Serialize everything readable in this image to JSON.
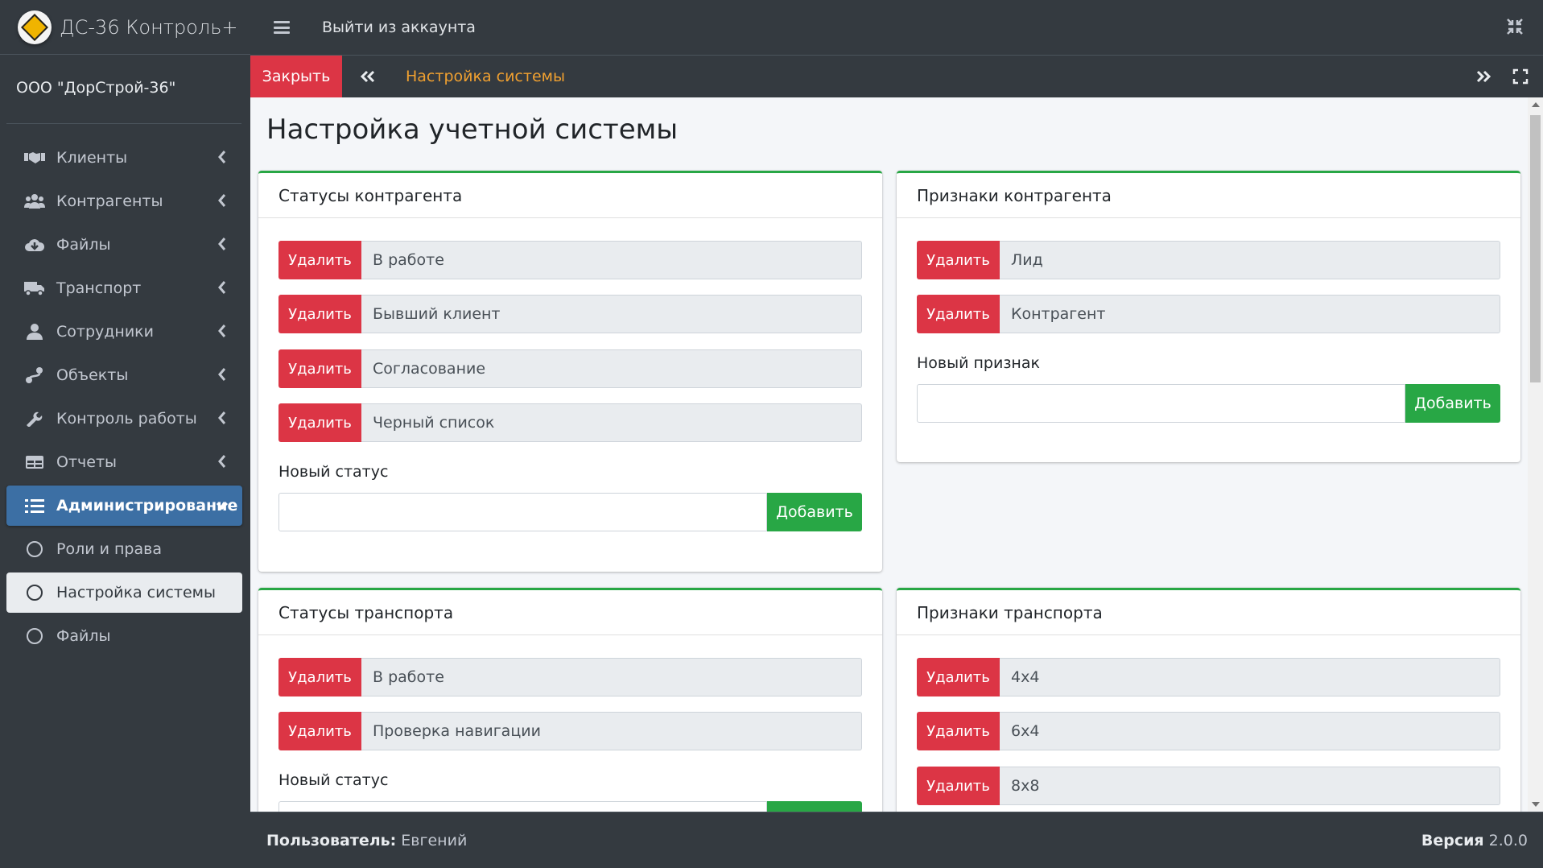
{
  "brand": {
    "name": "ДС-36 Контроль+"
  },
  "org": {
    "name": "ООО \"ДорСтрой-36\""
  },
  "sidebar": {
    "items": [
      {
        "label": "Клиенты",
        "icon": "handshake-icon"
      },
      {
        "label": "Контрагенты",
        "icon": "users-icon"
      },
      {
        "label": "Файлы",
        "icon": "cloud-download-icon"
      },
      {
        "label": "Транспорт",
        "icon": "truck-icon"
      },
      {
        "label": "Сотрудники",
        "icon": "user-icon"
      },
      {
        "label": "Объекты",
        "icon": "route-icon"
      },
      {
        "label": "Контроль работы",
        "icon": "wrench-icon"
      },
      {
        "label": "Отчеты",
        "icon": "table-icon"
      },
      {
        "label": "Администрирование",
        "icon": "list-icon"
      }
    ],
    "subitems": [
      {
        "label": "Роли и права"
      },
      {
        "label": "Настройка системы"
      },
      {
        "label": "Файлы"
      }
    ]
  },
  "topbar": {
    "logout_label": "Выйти из аккаунта"
  },
  "tabbar": {
    "close_label": "Закрыть",
    "active_tab": "Настройка системы"
  },
  "page": {
    "title": "Настройка учетной системы"
  },
  "cards": {
    "contractor_statuses": {
      "title": "Статусы контрагента",
      "delete_label": "Удалить",
      "items": [
        "В работе",
        "Бывший клиент",
        "Согласование",
        "Черный список"
      ],
      "new_label": "Новый статус",
      "new_value": "",
      "add_label": "Добавить"
    },
    "contractor_tags": {
      "title": "Признаки контрагента",
      "delete_label": "Удалить",
      "items": [
        "Лид",
        "Контрагент"
      ],
      "new_label": "Новый признак",
      "new_value": "",
      "add_label": "Добавить"
    },
    "transport_statuses": {
      "title": "Статусы транспорта",
      "delete_label": "Удалить",
      "items": [
        "В работе",
        "Проверка навигации"
      ],
      "new_label": "Новый статус"
    },
    "transport_tags": {
      "title": "Признаки транспорта",
      "delete_label": "Удалить",
      "items": [
        "4x4",
        "6x4",
        "8x8"
      ]
    }
  },
  "footer": {
    "user_label": "Пользователь:",
    "user_name": "Евгений",
    "version_label": "Версия",
    "version": "2.0.0"
  },
  "colors": {
    "sidebar_bg": "#343a40",
    "active": "#3c6fa4",
    "danger": "#dc3545",
    "success": "#28a745",
    "tab_accent": "#f0a030"
  }
}
